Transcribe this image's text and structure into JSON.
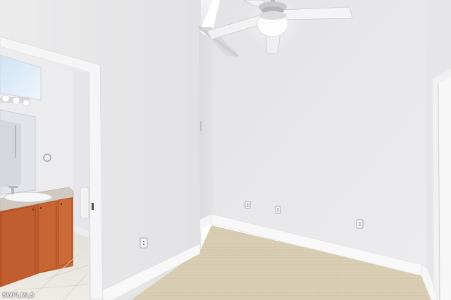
{
  "photo": {
    "watermark": "SWFLMLS"
  }
}
